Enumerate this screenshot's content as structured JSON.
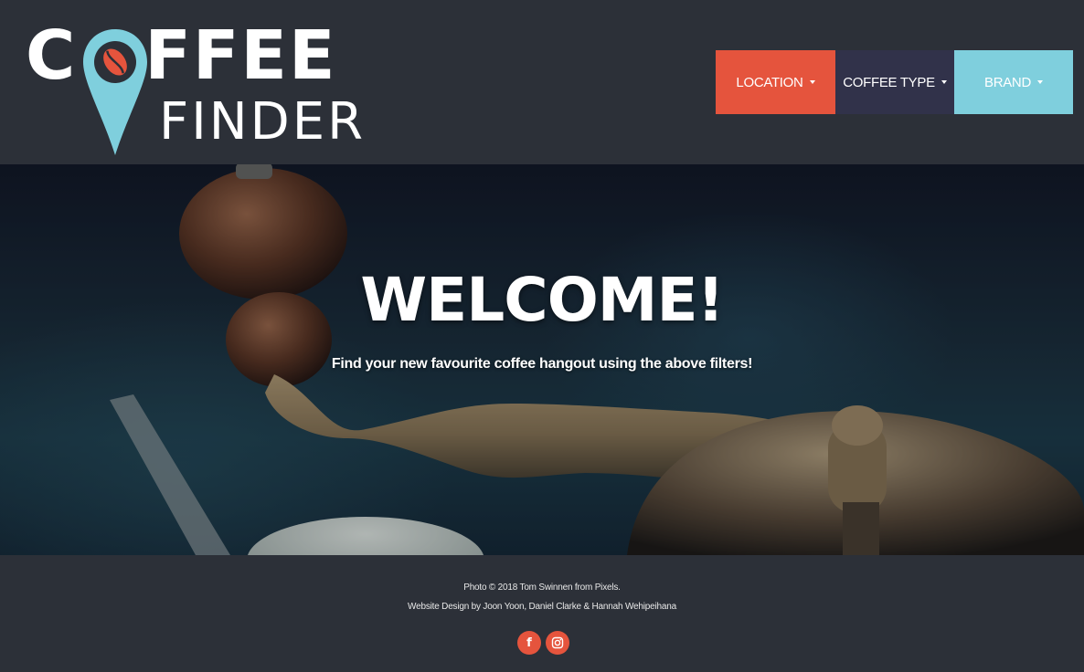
{
  "logo": {
    "word_top": "COFFEE",
    "word_bottom": "FINDER",
    "colors": {
      "pin": "#7fcfdd",
      "bean": "#e5543d",
      "text": "#ffffff"
    }
  },
  "nav": {
    "location_label": "LOCATION",
    "coffee_type_label": "COFFEE TYPE",
    "brand_label": "BRAND"
  },
  "hero": {
    "title": "WELCOME!",
    "subtitle": "Find your new favourite coffee hangout using the above filters!"
  },
  "footer": {
    "photo_credit": "Photo © 2018 Tom Swinnen from Pixels.",
    "design_credit": "Website Design by Joon Yoon, Daniel Clarke & Hannah Wehipeihana"
  },
  "social": {
    "icons": [
      "facebook-icon",
      "instagram-icon"
    ]
  },
  "colors": {
    "background": "#2c3038",
    "location": "#e5543d",
    "coffee_type": "#31324a",
    "brand": "#7fcfdd",
    "social": "#e5543d"
  }
}
